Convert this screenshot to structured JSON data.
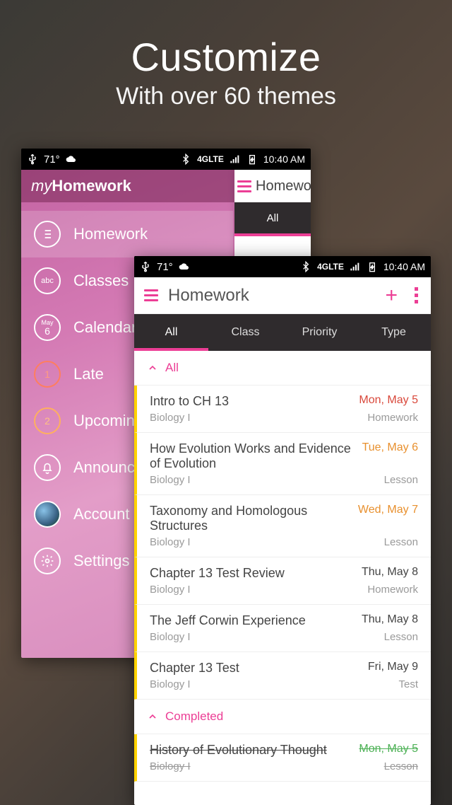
{
  "hero": {
    "title": "Customize",
    "subtitle": "With over 60 themes"
  },
  "statusbar": {
    "temp": "71°",
    "net": "4GLTE",
    "time": "10:40 AM"
  },
  "phoneA": {
    "brand_my": "my",
    "brand_hw": "Homework",
    "peek_title": "Homework",
    "peek_tab": "All",
    "menu": [
      {
        "key": "homework",
        "label": "Homework",
        "icon": "list",
        "active": true
      },
      {
        "key": "classes",
        "label": "Classes",
        "icon": "abc"
      },
      {
        "key": "calendar",
        "label": "Calendar",
        "icon": "cal",
        "cal_month": "May",
        "cal_day": "6"
      },
      {
        "key": "late",
        "label": "Late",
        "icon": "num",
        "num": "1",
        "variant": "red"
      },
      {
        "key": "upcoming",
        "label": "Upcoming",
        "icon": "num",
        "num": "2",
        "variant": "orange"
      },
      {
        "key": "announce",
        "label": "Announcements",
        "icon": "bell"
      },
      {
        "key": "account",
        "label": "Account",
        "icon": "avatar"
      },
      {
        "key": "settings",
        "label": "Settings",
        "icon": "gear"
      }
    ]
  },
  "phoneB": {
    "title": "Homework",
    "tabs": [
      "All",
      "Class",
      "Priority",
      "Type"
    ],
    "active_tab": 0,
    "section_all": "All",
    "section_completed": "Completed",
    "items": [
      {
        "name": "Intro to CH 13",
        "course": "Biology I",
        "date": "Mon, May 5",
        "kind": "Homework",
        "color": "red"
      },
      {
        "name": "How Evolution Works and Evidence of Evolution",
        "course": "Biology I",
        "date": "Tue, May 6",
        "kind": "Lesson",
        "color": "orange"
      },
      {
        "name": "Taxonomy and Homologous Structures",
        "course": "Biology I",
        "date": "Wed, May 7",
        "kind": "Lesson",
        "color": "orange"
      },
      {
        "name": "Chapter 13 Test Review",
        "course": "Biology I",
        "date": "Thu, May 8",
        "kind": "Homework",
        "color": "dark"
      },
      {
        "name": "The Jeff Corwin Experience",
        "course": "Biology I",
        "date": "Thu, May 8",
        "kind": "Lesson",
        "color": "dark"
      },
      {
        "name": "Chapter 13 Test",
        "course": "Biology I",
        "date": "Fri, May 9",
        "kind": "Test",
        "color": "dark"
      }
    ],
    "completed": [
      {
        "name": "History of Evolutionary Thought",
        "course": "Biology I",
        "date": "Mon, May 5",
        "kind": "Lesson",
        "color": "green"
      }
    ]
  }
}
